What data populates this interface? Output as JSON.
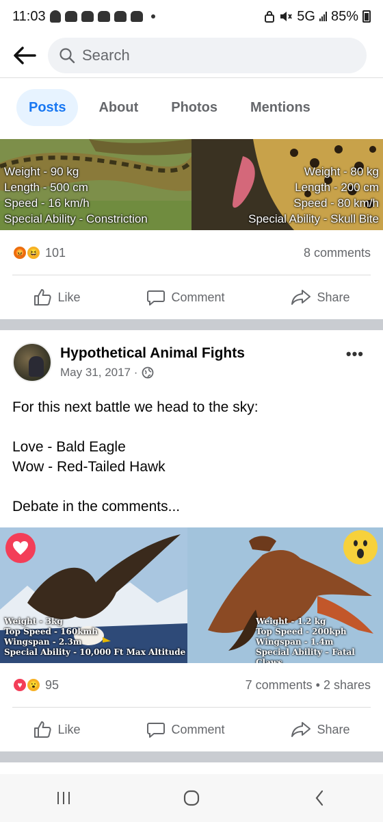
{
  "status_bar": {
    "time": "11:03",
    "network": "5G",
    "battery": "85%"
  },
  "search": {
    "placeholder": "Search"
  },
  "tabs": [
    {
      "label": "Posts",
      "active": true
    },
    {
      "label": "About",
      "active": false
    },
    {
      "label": "Photos",
      "active": false
    },
    {
      "label": "Mentions",
      "active": false
    }
  ],
  "post1": {
    "image_left_caption": [
      "Weight - 90 kg",
      "Length - 500 cm",
      "Speed - 16 km/h",
      "Special Ability - Constriction"
    ],
    "image_right_caption": [
      "Weight - 80 kg",
      "Length - 200 cm",
      "Speed - 80 km/h",
      "Special Ability - Skull Bite"
    ],
    "reaction_count": "101",
    "comments": "8 comments",
    "actions": {
      "like": "Like",
      "comment": "Comment",
      "share": "Share"
    }
  },
  "post2": {
    "page_name": "Hypothetical Animal Fights",
    "date": "May 31, 2017 ·",
    "lines": [
      "For this next battle we head to the sky:",
      "Love - Bald Eagle",
      "Wow - Red-Tailed Hawk",
      "Debate in the comments..."
    ],
    "image_left_caption": [
      "Weight - 3kg",
      "Top Speed - 160kmh",
      "Wingspan - 2.3m",
      "Special Ability - 10,000 Ft Max Altitude"
    ],
    "image_right_caption": [
      "Weight - 1.2 kg",
      "Top Speed - 200kph",
      "Wingspan - 1.4m",
      "Special Ability – Fatal Claws"
    ],
    "reaction_count": "95",
    "comments_shares": "7 comments • 2 shares",
    "actions": {
      "like": "Like",
      "comment": "Comment",
      "share": "Share"
    }
  },
  "colors": {
    "accent": "#1877f2",
    "tab_active_bg": "#e7f3ff",
    "muted_text": "#65676b",
    "separator": "#c9ccd1"
  }
}
